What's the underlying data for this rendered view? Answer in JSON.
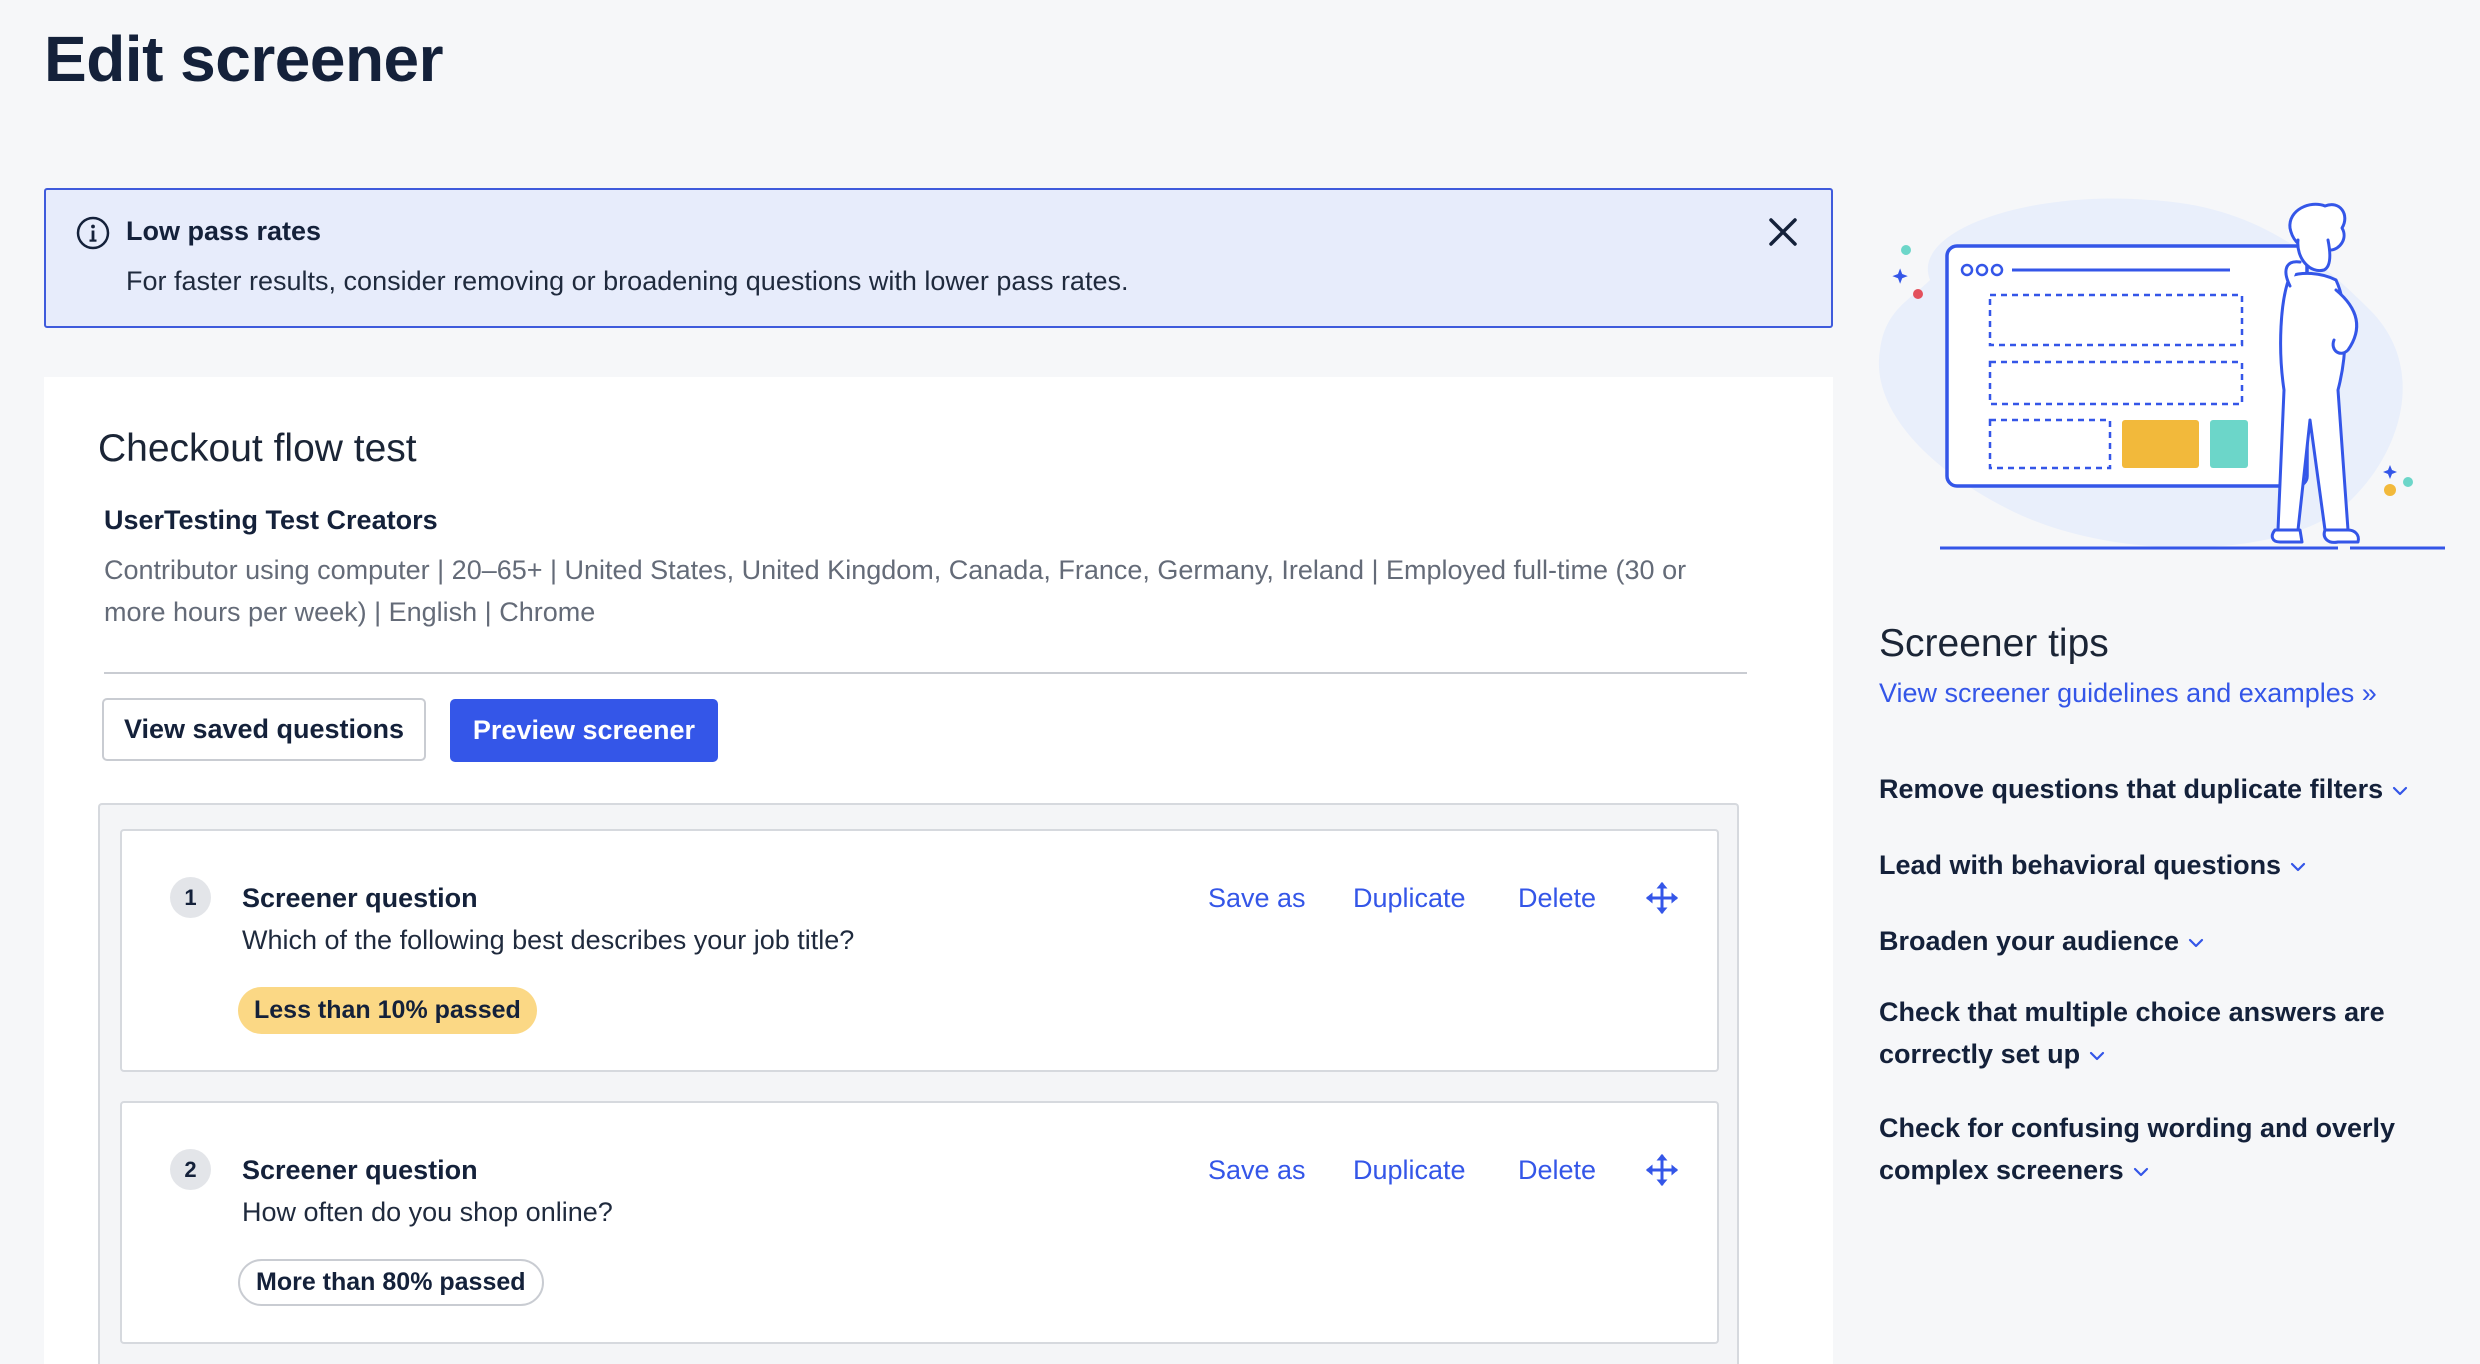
{
  "page": {
    "title": "Edit screener"
  },
  "alert": {
    "title": "Low pass rates",
    "body": "For faster results, consider removing or broadening questions with lower pass rates."
  },
  "test": {
    "title": "Checkout flow test",
    "audience_name": "UserTesting Test Creators",
    "audience_description": "Contributor using computer | 20–65+ | United States, United Kingdom, Canada, France, Germany, Ireland | Employed full-time (30 or more hours per week) | English | Chrome"
  },
  "buttons": {
    "view_saved": "View saved questions",
    "preview": "Preview screener"
  },
  "questions": [
    {
      "number": "1",
      "label": "Screener question",
      "text": "Which of the following best describes your job title?",
      "badge": "Less than 10% passed",
      "actions": {
        "save_as": "Save as",
        "duplicate": "Duplicate",
        "delete": "Delete"
      }
    },
    {
      "number": "2",
      "label": "Screener question",
      "text": "How often do you shop online?",
      "badge": "More than 80% passed",
      "actions": {
        "save_as": "Save as",
        "duplicate": "Duplicate",
        "delete": "Delete"
      }
    }
  ],
  "tips": {
    "title": "Screener tips",
    "link": "View screener guidelines and examples »",
    "items": [
      "Remove questions that duplicate filters",
      "Lead with behavioral questions",
      "Broaden your audience",
      "Check that multiple choice answers are correctly set up",
      "Check for confusing wording and overly complex screeners"
    ]
  },
  "colors": {
    "accent": "#3456e8",
    "alert_bg": "#e7ecfb",
    "badge_low": "#fbd885",
    "illustration_yellow": "#f2b93b",
    "illustration_teal": "#6cd6c9"
  }
}
